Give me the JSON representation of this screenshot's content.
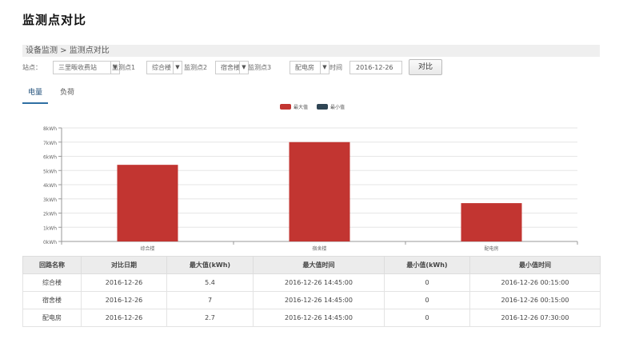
{
  "page": {
    "title": "监测点对比"
  },
  "breadcrumb": "设备监测 > 监测点对比",
  "filters": {
    "station_label": "站点：",
    "station_value": "三里畈收费站",
    "point1_label": "监测点1",
    "point1_value": "综合楼",
    "point2_label": "监测点2",
    "point2_value": "宿舍楼",
    "point3_label": "监测点3",
    "point3_value": "配电房",
    "time_label": "时间",
    "date_value": "2016-12-26",
    "compare_button": "对比"
  },
  "tabs": [
    {
      "label": "电量"
    },
    {
      "label": "负荷"
    }
  ],
  "colors": {
    "max": "#c23531",
    "min": "#2f4554",
    "accent": "#2f6fa3"
  },
  "chart_data": {
    "type": "bar",
    "categories": [
      "综合楼",
      "宿舍楼",
      "配电房"
    ],
    "series": [
      {
        "name": "最大值",
        "values": [
          5.4,
          7,
          2.7
        ]
      },
      {
        "name": "最小值",
        "values": [
          0,
          0,
          0
        ]
      }
    ],
    "ylim": [
      0,
      8
    ],
    "yticks": [
      "0kWh",
      "1kWh",
      "2kWh",
      "3kWh",
      "4kWh",
      "5kWh",
      "6kWh",
      "7kWh",
      "8kWh"
    ],
    "legend": "top-center",
    "grid": true
  },
  "table": {
    "headers": [
      "回路名称",
      "对比日期",
      "最大值(kWh)",
      "最大值时间",
      "最小值(kWh)",
      "最小值时间"
    ],
    "rows": [
      [
        "综合楼",
        "2016-12-26",
        "5.4",
        "2016-12-26 14:45:00",
        "0",
        "2016-12-26 00:15:00"
      ],
      [
        "宿舍楼",
        "2016-12-26",
        "7",
        "2016-12-26 14:45:00",
        "0",
        "2016-12-26 00:15:00"
      ],
      [
        "配电房",
        "2016-12-26",
        "2.7",
        "2016-12-26 14:45:00",
        "0",
        "2016-12-26 07:30:00"
      ]
    ]
  }
}
